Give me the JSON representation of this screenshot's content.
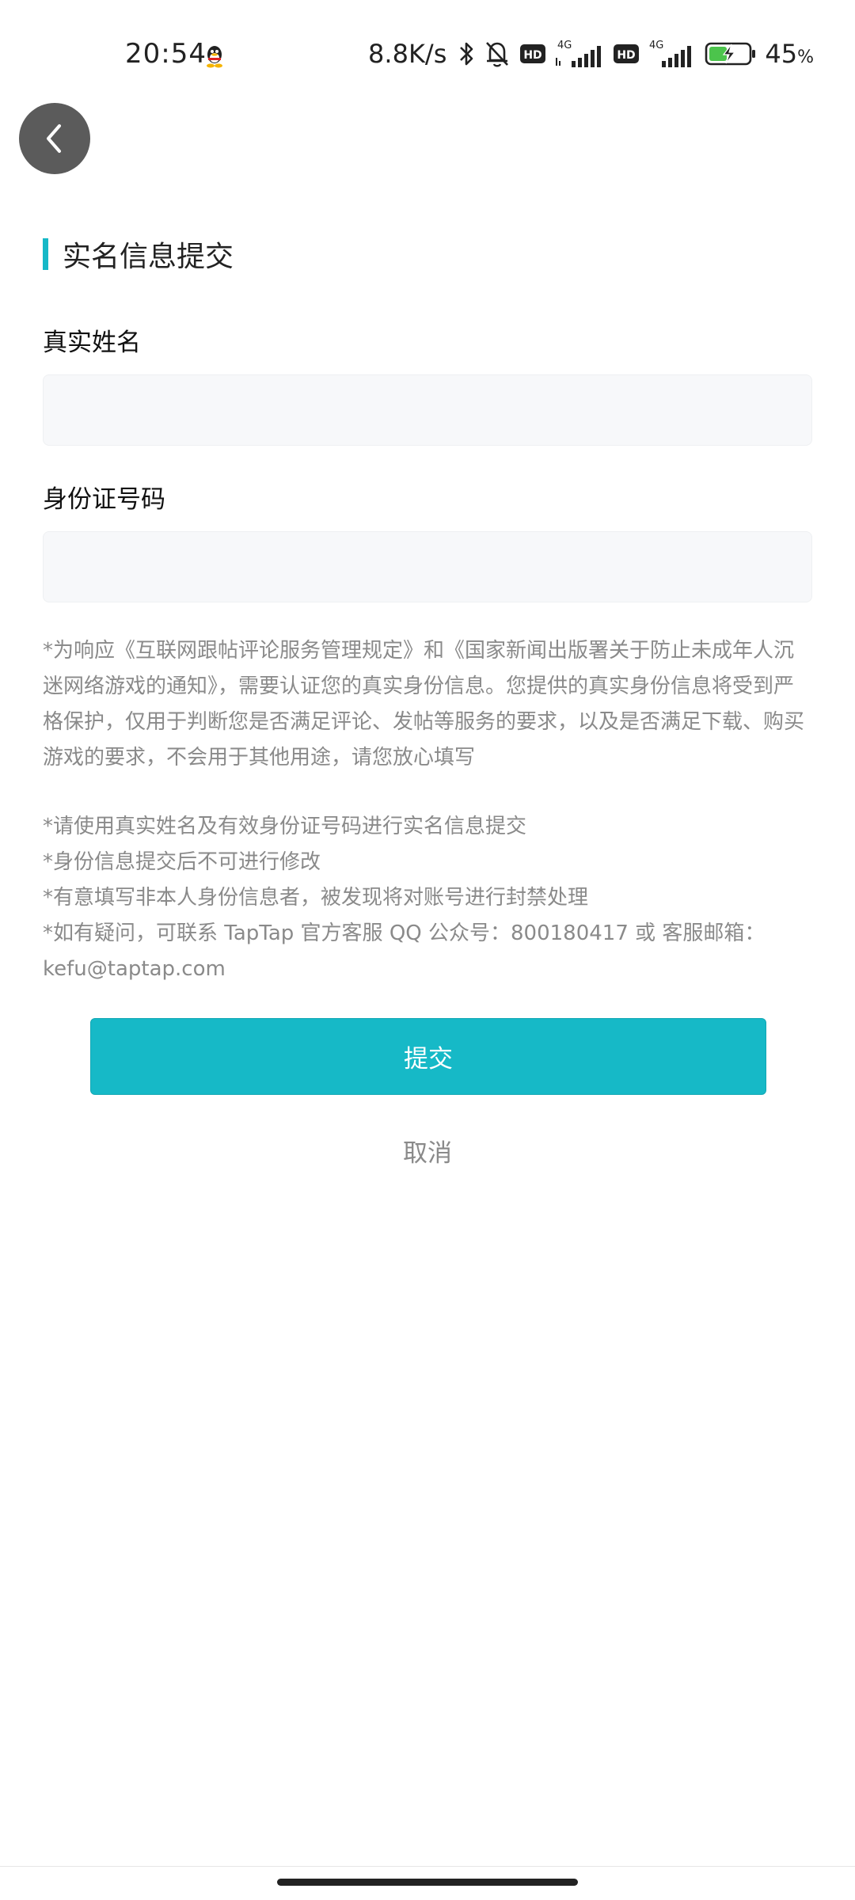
{
  "status_bar": {
    "time": "20:54",
    "net_speed": "8.8K/s",
    "network_type_1": "4G",
    "network_type_2": "4G",
    "hd_label": "HD",
    "battery_percent": "45",
    "battery_percent_sign": "%",
    "icons": [
      "qq-icon",
      "bluetooth-icon",
      "mute-bell-icon",
      "hd-icon",
      "signal-icon",
      "battery-charging-icon"
    ]
  },
  "header": {
    "back_icon": "chevron-left-icon"
  },
  "form": {
    "title": "实名信息提交",
    "name_label": "真实姓名",
    "name_value": "",
    "id_label": "身份证号码",
    "id_value": ""
  },
  "notice": {
    "paragraph": "*为响应《互联网跟帖评论服务管理规定》和《国家新闻出版署关于防止未成年人沉迷网络游戏的通知》，需要认证您的真实身份信息。您提供的真实身份信息将受到严格保护，仅用于判断您是否满足评论、发帖等服务的要求，以及是否满足下载、购买游戏的要求，不会用于其他用途，请您放心填写",
    "rules": [
      "*请使用真实姓名及有效身份证号码进行实名信息提交",
      "*身份信息提交后不可进行修改",
      "*有意填写非本人身份信息者，被发现将对账号进行封禁处理",
      "*如有疑问，可联系 TapTap 官方客服 QQ 公众号：800180417 或 客服邮箱：kefu@taptap.com"
    ]
  },
  "actions": {
    "submit_label": "提交",
    "cancel_label": "取消"
  },
  "colors": {
    "accent": "#16b9c7",
    "muted_text": "#8a8a8a",
    "back_button_bg": "#5b5b5b"
  }
}
